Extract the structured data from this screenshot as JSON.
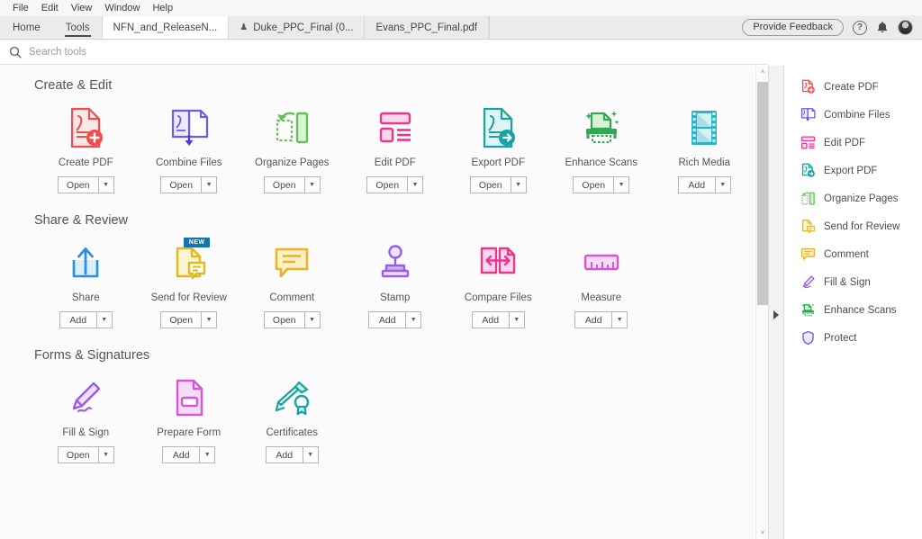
{
  "menubar": {
    "items": [
      {
        "label": "File"
      },
      {
        "label": "Edit"
      },
      {
        "label": "View"
      },
      {
        "label": "Window"
      },
      {
        "label": "Help"
      }
    ]
  },
  "tabbar": {
    "nav_tabs": [
      {
        "label": "Home",
        "active": false
      },
      {
        "label": "Tools",
        "active": true
      }
    ],
    "doc_tabs": [
      {
        "label": "NFN_and_ReleaseN...",
        "selected": true,
        "has_shield_icon": false
      },
      {
        "label": "Duke_PPC_Final (0...",
        "selected": false,
        "has_shield_icon": true
      },
      {
        "label": "Evans_PPC_Final.pdf",
        "selected": false,
        "has_shield_icon": false
      }
    ],
    "feedback_label": "Provide Feedback",
    "help_icon": "question-mark-icon",
    "help_glyph": "?",
    "bell_icon": "notification-bell-icon",
    "avatar_icon": "user-avatar"
  },
  "search": {
    "placeholder": "Search tools",
    "value": "",
    "icon": "search-icon"
  },
  "sections": [
    {
      "title": "Create & Edit",
      "tools": [
        {
          "label": "Create PDF",
          "button": "Open",
          "icon": "create-pdf-icon",
          "color": "#f04e50"
        },
        {
          "label": "Combine Files",
          "button": "Open",
          "icon": "combine-files-icon",
          "color": "#6c5ce7"
        },
        {
          "label": "Organize Pages",
          "button": "Open",
          "icon": "organize-pages-icon",
          "color": "#62c254"
        },
        {
          "label": "Edit PDF",
          "button": "Open",
          "icon": "edit-pdf-icon",
          "color": "#e8388e"
        },
        {
          "label": "Export PDF",
          "button": "Open",
          "icon": "export-pdf-icon",
          "color": "#17a3a3"
        },
        {
          "label": "Enhance Scans",
          "button": "Open",
          "icon": "enhance-scans-icon",
          "color": "#33a852"
        },
        {
          "label": "Rich Media",
          "button": "Add",
          "icon": "rich-media-icon",
          "color": "#2eb3c4"
        }
      ]
    },
    {
      "title": "Share & Review",
      "tools": [
        {
          "label": "Share",
          "button": "Add",
          "icon": "share-icon",
          "color": "#2a8fe0"
        },
        {
          "label": "Send for Review",
          "button": "Open",
          "icon": "send-for-review-icon",
          "color": "#e0b81f",
          "badge": "NEW"
        },
        {
          "label": "Comment",
          "button": "Open",
          "icon": "comment-icon",
          "color": "#e8b424"
        },
        {
          "label": "Stamp",
          "button": "Add",
          "icon": "stamp-icon",
          "color": "#9b5de5"
        },
        {
          "label": "Compare Files",
          "button": "Add",
          "icon": "compare-files-icon",
          "color": "#e8388e"
        },
        {
          "label": "Measure",
          "button": "Add",
          "icon": "measure-icon",
          "color": "#d457d4"
        }
      ]
    },
    {
      "title": "Forms & Signatures",
      "tools": [
        {
          "label": "Fill & Sign",
          "button": "Open",
          "icon": "fill-and-sign-icon",
          "color": "#9b5de5"
        },
        {
          "label": "Prepare Form",
          "button": "Add",
          "icon": "prepare-form-icon",
          "color": "#d457d4"
        },
        {
          "label": "Certificates",
          "button": "Add",
          "icon": "certificates-icon",
          "color": "#17a3a3"
        }
      ]
    }
  ],
  "right_panel": {
    "items": [
      {
        "label": "Create PDF",
        "icon": "create-pdf-icon",
        "color": "#f04e50"
      },
      {
        "label": "Combine Files",
        "icon": "combine-files-icon",
        "color": "#6c5ce7"
      },
      {
        "label": "Edit PDF",
        "icon": "edit-pdf-icon",
        "color": "#e8388e"
      },
      {
        "label": "Export PDF",
        "icon": "export-pdf-icon",
        "color": "#17a3a3"
      },
      {
        "label": "Organize Pages",
        "icon": "organize-pages-icon",
        "color": "#62c254"
      },
      {
        "label": "Send for Review",
        "icon": "send-for-review-icon",
        "color": "#e0b81f"
      },
      {
        "label": "Comment",
        "icon": "comment-icon",
        "color": "#e8b424"
      },
      {
        "label": "Fill & Sign",
        "icon": "fill-and-sign-icon",
        "color": "#9b5de5"
      },
      {
        "label": "Enhance Scans",
        "icon": "enhance-scans-icon",
        "color": "#33a852"
      },
      {
        "label": "Protect",
        "icon": "protect-icon",
        "color": "#6c5ce7"
      }
    ]
  },
  "scrollbar": {
    "up_glyph": "˄",
    "down_glyph": "˅"
  },
  "colors": {
    "accent_blue": "#1473b5",
    "panel_bg": "#fbfbfb",
    "tabbar_bg": "#ebebeb"
  }
}
